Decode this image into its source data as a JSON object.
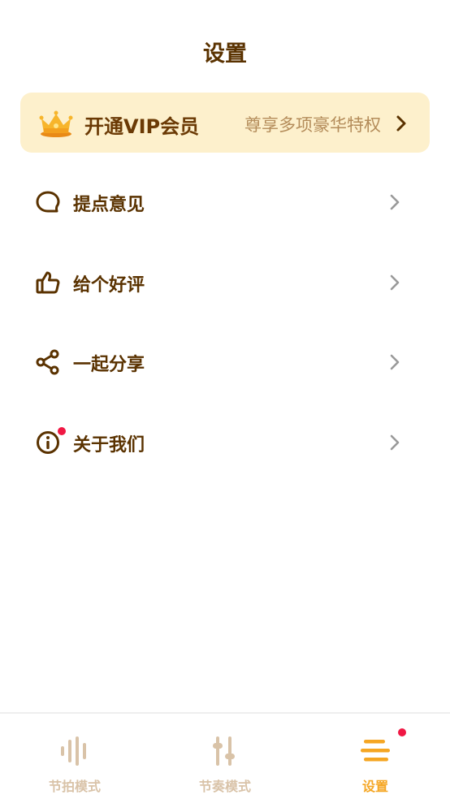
{
  "header": {
    "title": "设置"
  },
  "vip_banner": {
    "label": "开通VIP会员",
    "subtitle": "尊享多项豪华特权"
  },
  "menu": [
    {
      "label": "提点意见",
      "icon": "chat-bubble-icon"
    },
    {
      "label": "给个好评",
      "icon": "thumbs-up-icon"
    },
    {
      "label": "一起分享",
      "icon": "share-icon"
    },
    {
      "label": "关于我们",
      "icon": "info-icon"
    }
  ],
  "tabs": [
    {
      "label": "节拍模式",
      "icon": "sound-bars-icon",
      "active": false
    },
    {
      "label": "节奏模式",
      "icon": "sliders-icon",
      "active": false
    },
    {
      "label": "设置",
      "icon": "menu-lines-icon",
      "active": true
    }
  ],
  "colors": {
    "primary_text": "#5a3200",
    "vip_background": "#fdf0cc",
    "vip_subtitle": "#b48c5a",
    "active_tab": "#f5a623",
    "inactive_tab": "#d9c3a8",
    "badge": "#f01844",
    "chevron": "#999999"
  }
}
